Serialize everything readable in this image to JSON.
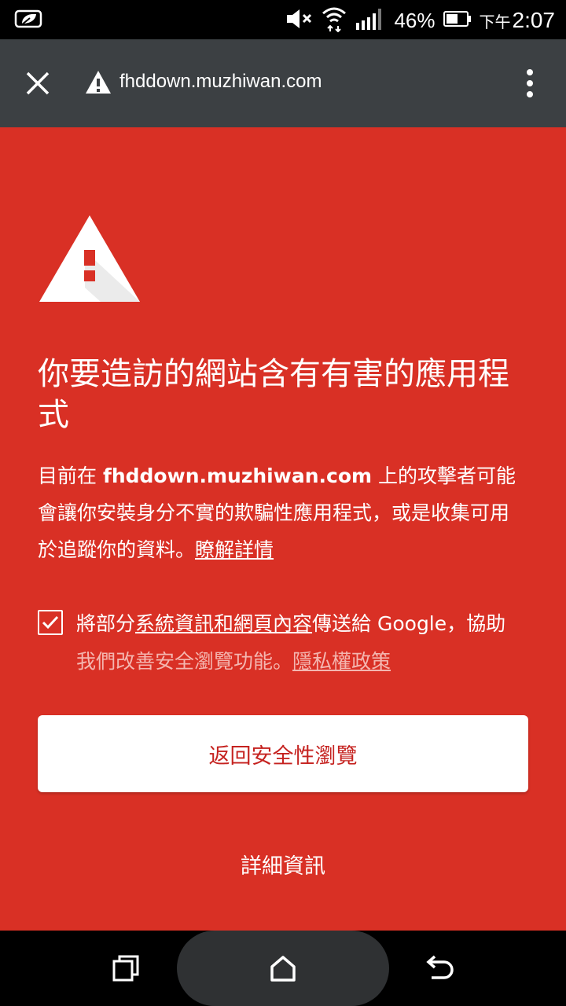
{
  "status_bar": {
    "battery_percent": "46%",
    "time_period": "下午",
    "time": "2:07",
    "icons": [
      "notification-leaf-icon",
      "mute-icon",
      "wifi-icon",
      "signal-icon",
      "battery-icon"
    ]
  },
  "toolbar": {
    "url": "fhddown.muzhiwan.com",
    "icons": [
      "close-icon",
      "warning-icon",
      "overflow-menu-icon"
    ]
  },
  "interstitial": {
    "title": "你要造訪的網站含有有害的應用程式",
    "desc_prefix": "目前在 ",
    "desc_domain": "fhddown.muzhiwan.com",
    "desc_suffix": " 上的攻擊者可能會讓你安裝身分不實的欺騙性應用程式，或是收集可用於追蹤你的資料。",
    "learn_more": "瞭解詳情",
    "optin_prefix": "將部分",
    "optin_link": "系統資訊和網頁內容",
    "optin_suffix": "傳送給 Google，協助",
    "optin_dim": "我們改善安全瀏覽功能。",
    "privacy_link": "隱私權政策",
    "checkbox_checked": true,
    "back_button": "返回安全性瀏覽",
    "details_link": "詳細資訊"
  },
  "nav_bar": {
    "icons": [
      "recents-icon",
      "home-icon",
      "back-icon"
    ]
  },
  "colors": {
    "background": "#d93025",
    "toolbar": "#3c4043",
    "button_text": "#c5221f"
  }
}
